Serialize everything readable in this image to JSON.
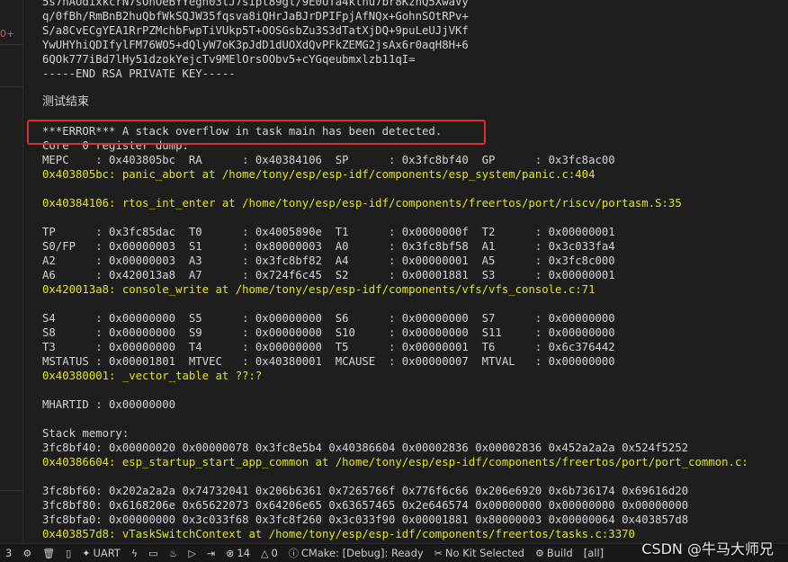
{
  "gutter": {
    "marker": "0+"
  },
  "terminal": {
    "lines": [
      {
        "text": "5s7hAUdixkcrN7sOhOeBYYegn03tJ7sipt89gl/9E0UTa4kthu7br8KznQ5XwaVy",
        "color": "white"
      },
      {
        "text": "q/0fBh/RmBnB2huQbfWkSQJW35fqsva8iQHrJaBJrDPIFpjAfNQx+GohnSOtRPv+",
        "color": "white"
      },
      {
        "text": "S/a8CvECgYEA1RrPZMchbFwpTiVUkp5T+OOSGsbZu3S3dTatXjDQ+9puLeUJjVKf",
        "color": "white"
      },
      {
        "text": "YwUHYhiQDIfylFM76WO5+dQlyW7oK3pJdD1dUOXdQvPFkZEMG2jsAx6r0aqH8H+6",
        "color": "white"
      },
      {
        "text": "6QOk777iBd7lHy51dzokYejcTv9MElOrsOObv5+cYGqeubmxlzb11qI=",
        "color": "white"
      },
      {
        "text": "-----END RSA PRIVATE KEY-----",
        "color": "white"
      },
      {
        "text": "",
        "color": "white"
      },
      {
        "text": "测试结束",
        "color": "white",
        "zh": true
      },
      {
        "text": "",
        "color": "white"
      },
      {
        "text": "***ERROR*** A stack overflow in task main has been detected.",
        "color": "white"
      },
      {
        "text": "Core  0 register dump:",
        "color": "white"
      },
      {
        "text": "MEPC    : 0x403805bc  RA      : 0x40384106  SP      : 0x3fc8bf40  GP      : 0x3fc8ac00",
        "color": "white"
      },
      {
        "text": "0x403805bc: panic_abort at /home/tony/esp/esp-idf/components/esp_system/panic.c:404",
        "color": "yellow"
      },
      {
        "text": "",
        "color": "white"
      },
      {
        "text": "0x40384106: rtos_int_enter at /home/tony/esp/esp-idf/components/freertos/port/riscv/portasm.S:35",
        "color": "yellow"
      },
      {
        "text": "",
        "color": "white"
      },
      {
        "text": "TP      : 0x3fc85dac  T0      : 0x4005890e  T1      : 0x0000000f  T2      : 0x00000001",
        "color": "white"
      },
      {
        "text": "S0/FP   : 0x00000003  S1      : 0x80000003  A0      : 0x3fc8bf58  A1      : 0x3c033fa4",
        "color": "white"
      },
      {
        "text": "A2      : 0x00000003  A3      : 0x3fc8bf82  A4      : 0x00000001  A5      : 0x3fc8c000",
        "color": "white"
      },
      {
        "text": "A6      : 0x420013a8  A7      : 0x724f6c45  S2      : 0x00001881  S3      : 0x00000001",
        "color": "white"
      },
      {
        "text": "0x420013a8: console_write at /home/tony/esp/esp-idf/components/vfs/vfs_console.c:71",
        "color": "yellow"
      },
      {
        "text": "",
        "color": "white"
      },
      {
        "text": "S4      : 0x00000000  S5      : 0x00000000  S6      : 0x00000000  S7      : 0x00000000",
        "color": "white"
      },
      {
        "text": "S8      : 0x00000000  S9      : 0x00000000  S10     : 0x00000000  S11     : 0x00000000",
        "color": "white"
      },
      {
        "text": "T3      : 0x00000000  T4      : 0x00000000  T5      : 0x00000001  T6      : 0x6c376442",
        "color": "white"
      },
      {
        "text": "MSTATUS : 0x00001801  MTVEC   : 0x40380001  MCAUSE  : 0x00000007  MTVAL   : 0x00000000",
        "color": "white"
      },
      {
        "text": "0x40380001: _vector_table at ??:?",
        "color": "yellow"
      },
      {
        "text": "",
        "color": "white"
      },
      {
        "text": "MHARTID : 0x00000000",
        "color": "white"
      },
      {
        "text": "",
        "color": "white"
      },
      {
        "text": "Stack memory:",
        "color": "white"
      },
      {
        "text": "3fc8bf40: 0x00000020 0x00000078 0x3fc8e5b4 0x40386604 0x00002836 0x00002836 0x452a2a2a 0x524f5252",
        "color": "white"
      },
      {
        "text": "0x40386604: esp_startup_start_app_common at /home/tony/esp/esp-idf/components/freertos/port/port_common.c:",
        "color": "yellow"
      },
      {
        "text": "",
        "color": "white"
      },
      {
        "text": "3fc8bf60: 0x202a2a2a 0x74732041 0x206b6361 0x7265766f 0x776f6c66 0x206e6920 0x6b736174 0x69616d20",
        "color": "white"
      },
      {
        "text": "3fc8bf80: 0x6168206e 0x65622073 0x64206e65 0x63657465 0x2e646574 0x00000000 0x00000000 0x00000000",
        "color": "white"
      },
      {
        "text": "3fc8bfa0: 0x00000000 0x3c033f68 0x3fc8f260 0x3c033f90 0x00001881 0x80000003 0x00000064 0x403857d8",
        "color": "white"
      },
      {
        "text": "0x403857d8: vTaskSwitchContext at /home/tony/esp/esp-idf/components/freertos/tasks.c:3370",
        "color": "yellow"
      }
    ]
  },
  "statusbar": {
    "items": [
      {
        "icon": "gear-icon",
        "glyph": "⚙",
        "label": ""
      },
      {
        "icon": "trash-icon",
        "glyph": "🗑",
        "label": ""
      },
      {
        "icon": "file-icon",
        "glyph": "▯",
        "label": ""
      },
      {
        "icon": "star-icon",
        "glyph": "✦",
        "label": "UART"
      },
      {
        "icon": "flash-icon",
        "glyph": "ϟ",
        "label": ""
      },
      {
        "icon": "monitor-icon",
        "glyph": "▭",
        "label": ""
      },
      {
        "icon": "flame-icon",
        "glyph": "♨",
        "label": ""
      },
      {
        "icon": "terminal-icon",
        "glyph": "▷",
        "label": ""
      },
      {
        "icon": "export-icon",
        "glyph": "⇥",
        "label": ""
      },
      {
        "icon": "error-icon",
        "glyph": "⊗",
        "label": "14"
      },
      {
        "icon": "warning-icon",
        "glyph": "△",
        "label": "0"
      },
      {
        "icon": "info-icon",
        "glyph": "ⓘ",
        "label": "CMake: [Debug]: Ready"
      },
      {
        "icon": "kit-icon",
        "glyph": "✂",
        "label": "No Kit Selected"
      },
      {
        "icon": "build-icon",
        "glyph": "⚙",
        "label": "Build"
      },
      {
        "icon": "target-icon",
        "glyph": "",
        "label": "[all]"
      }
    ],
    "leading": "3"
  },
  "watermark": "CSDN @牛马大师兄"
}
